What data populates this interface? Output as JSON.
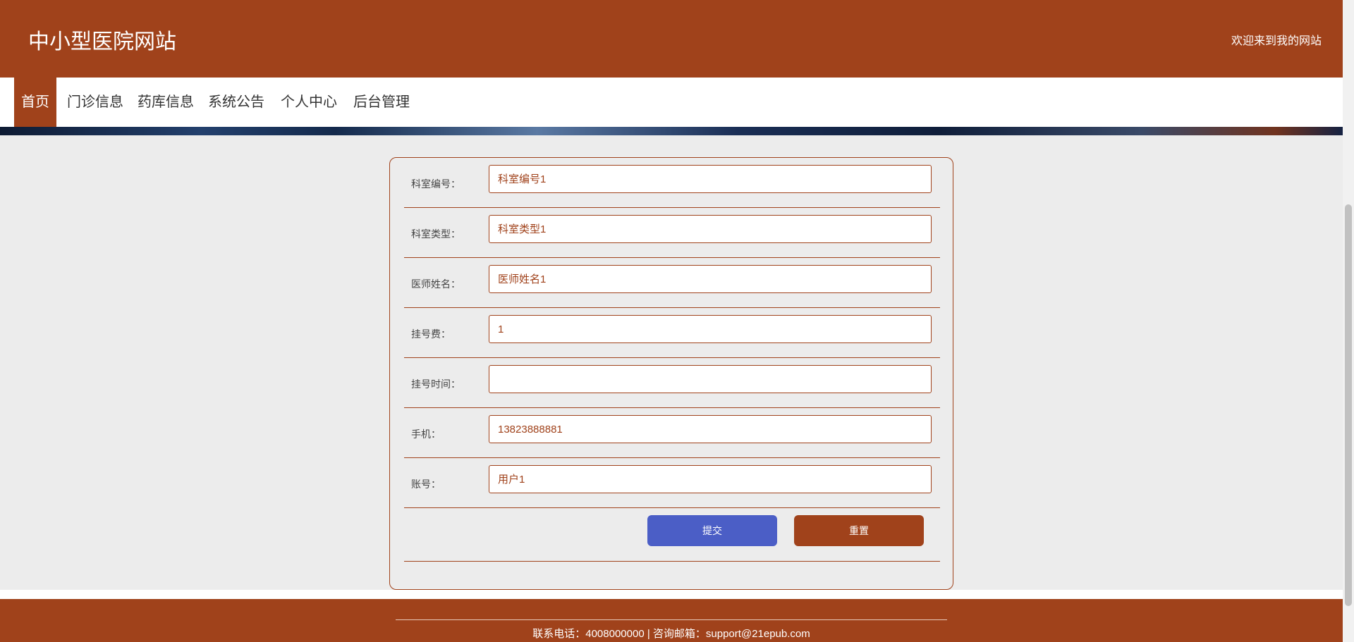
{
  "header": {
    "site_title": "中小型医院网站",
    "welcome": "欢迎来到我的网站"
  },
  "nav": {
    "items": [
      {
        "label": "首页",
        "active": true
      },
      {
        "label": "门诊信息",
        "active": false
      },
      {
        "label": "药库信息",
        "active": false
      },
      {
        "label": "系统公告",
        "active": false
      },
      {
        "label": "个人中心",
        "active": false
      },
      {
        "label": "后台管理",
        "active": false
      }
    ]
  },
  "form": {
    "fields": [
      {
        "label": "科室编号：",
        "value": "科室编号1"
      },
      {
        "label": "科室类型：",
        "value": "科室类型1"
      },
      {
        "label": "医师姓名：",
        "value": "医师姓名1"
      },
      {
        "label": "挂号费：",
        "value": "1"
      },
      {
        "label": "挂号时间：",
        "value": ""
      },
      {
        "label": "手机：",
        "value": "13823888881"
      },
      {
        "label": "账号：",
        "value": "用户1"
      }
    ],
    "submit_label": "提交",
    "reset_label": "重置"
  },
  "footer": {
    "contact": "联系电话：4008000000 | 咨询邮箱：support@21epub.com"
  },
  "colors": {
    "brand": "#a0421b",
    "submit": "#4b5ec6",
    "background": "#ececec"
  }
}
